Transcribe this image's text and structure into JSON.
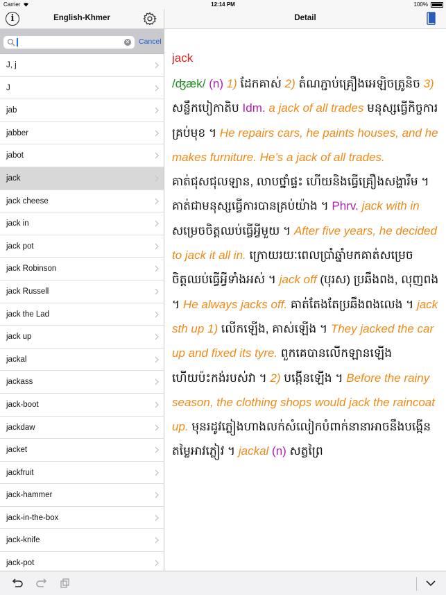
{
  "status_bar": {
    "carrier": "Carrier",
    "time": "12:14 PM",
    "battery": "100%"
  },
  "left_nav": {
    "title": "English-Khmer"
  },
  "search": {
    "value": "j",
    "cancel_label": "Cancel"
  },
  "words": [
    {
      "label": "J, j",
      "selected": false
    },
    {
      "label": "J",
      "selected": false
    },
    {
      "label": "jab",
      "selected": false
    },
    {
      "label": "jabber",
      "selected": false
    },
    {
      "label": "jabot",
      "selected": false
    },
    {
      "label": "jack",
      "selected": true
    },
    {
      "label": "jack cheese",
      "selected": false
    },
    {
      "label": "jack in",
      "selected": false
    },
    {
      "label": "jack pot",
      "selected": false
    },
    {
      "label": "jack Robinson",
      "selected": false
    },
    {
      "label": "jack Russell",
      "selected": false
    },
    {
      "label": "jack the Lad",
      "selected": false
    },
    {
      "label": "jack up",
      "selected": false
    },
    {
      "label": "jackal",
      "selected": false
    },
    {
      "label": "jackass",
      "selected": false
    },
    {
      "label": "jack-boot",
      "selected": false
    },
    {
      "label": "jackdaw",
      "selected": false
    },
    {
      "label": "jacket",
      "selected": false
    },
    {
      "label": "jackfruit",
      "selected": false
    },
    {
      "label": "jack-hammer",
      "selected": false
    },
    {
      "label": "jack-in-the-box",
      "selected": false
    },
    {
      "label": "jack-knife",
      "selected": false
    },
    {
      "label": "jack-pot",
      "selected": false
    }
  ],
  "right_nav": {
    "title": "Detail"
  },
  "entry": {
    "headword": "jack",
    "segments": [
      {
        "t": "phon",
        "v": "/ʤæk/ "
      },
      {
        "t": "pos",
        "v": "(n) "
      },
      {
        "t": "eng",
        "v": "1) "
      },
      {
        "t": "kh",
        "v": "ដែកគាស់ "
      },
      {
        "t": "eng",
        "v": "2) "
      },
      {
        "t": "kh",
        "v": "តំណភ្ជាប់គ្រឿងអេឡិចត្រូនិច "
      },
      {
        "t": "eng",
        "v": "3) "
      },
      {
        "t": "kh",
        "v": "សន្លឹកបៀកាតិប "
      },
      {
        "t": "pos",
        "v": "Idm. "
      },
      {
        "t": "eng",
        "v": "a jack of all trades "
      },
      {
        "t": "kh",
        "v": "មនុស្សធ្វើកិច្ចការគ្រប់មុខ ។ "
      },
      {
        "t": "eng",
        "v": "He repairs cars, he paints houses, and he makes furniture. He’s a jack of all trades. "
      },
      {
        "t": "kh",
        "v": "គាត់ជុសជុលឡាន, លាបថ្នាំផ្ទះ ហើយនិងធ្វើគ្រឿងសង្ហារឹម ។ គាត់ជាមនុស្សធ្វើការបានគ្រប់យ៉ាង ។ "
      },
      {
        "t": "pos",
        "v": "Phrv. "
      },
      {
        "t": "eng",
        "v": "jack with in "
      },
      {
        "t": "kh",
        "v": "សម្រេចចិត្តឈប់ធ្វើអ្វីមួយ ។ "
      },
      {
        "t": "eng",
        "v": "After five years, he decided to jack it all in. "
      },
      {
        "t": "kh",
        "v": "ក្រោយរយៈពេលប្រាំឆ្នាំមកគាត់សម្រេចចិត្តឈប់ធ្វើអ្វីទាំងអស់ ។ "
      },
      {
        "t": "eng",
        "v": "jack off "
      },
      {
        "t": "kh",
        "v": "(បុរស) ប្រឆឹងពង, លុញពង ។ "
      },
      {
        "t": "eng",
        "v": "He always jacks off. "
      },
      {
        "t": "kh",
        "v": "គាត់តែងតែប្រឆឹងពងលេង ។ "
      },
      {
        "t": "eng",
        "v": "jack sth up 1) "
      },
      {
        "t": "kh",
        "v": "លើកឡើង, គាស់ឡើង ។ "
      },
      {
        "t": "eng",
        "v": "They jacked the car up and fixed its tyre. "
      },
      {
        "t": "kh",
        "v": "ពួកគេបានលើកឡានឡើង ហើយប៉ះកង់របស់វា ។ "
      },
      {
        "t": "eng",
        "v": "2) "
      },
      {
        "t": "kh",
        "v": "បង្កើនឡើង ។ "
      },
      {
        "t": "eng",
        "v": "Before the rainy season, the clothing shops would jack the raincoat up. "
      },
      {
        "t": "kh",
        "v": "មុនរដូវភ្លៀងហាងលក់សំលៀកបំពាក់នានាអាចនឹងបង្កើនតម្លៃអាវភ្លៀវ ។ "
      },
      {
        "t": "eng",
        "v": "jackal "
      },
      {
        "t": "pos",
        "v": "(n) "
      },
      {
        "t": "kh",
        "v": "សត្វព្រៃ"
      }
    ]
  },
  "icons": {
    "info": "info-icon",
    "settings": "gear-icon",
    "search": "search-icon",
    "clear": "clear-icon",
    "chevron": "chevron-right-icon",
    "book": "book-icon",
    "undo": "undo-icon",
    "redo": "redo-icon",
    "copy": "copy-icon",
    "collapse": "chevron-down-icon"
  },
  "colors": {
    "headword": "#e02020",
    "phonetic": "#1e8a1e",
    "part_of_speech": "#b01fb0",
    "english_example": "#f08a17",
    "khmer_text": "#111111",
    "accent": "#1a5fd6",
    "selected_row": "#d8d8d8"
  }
}
